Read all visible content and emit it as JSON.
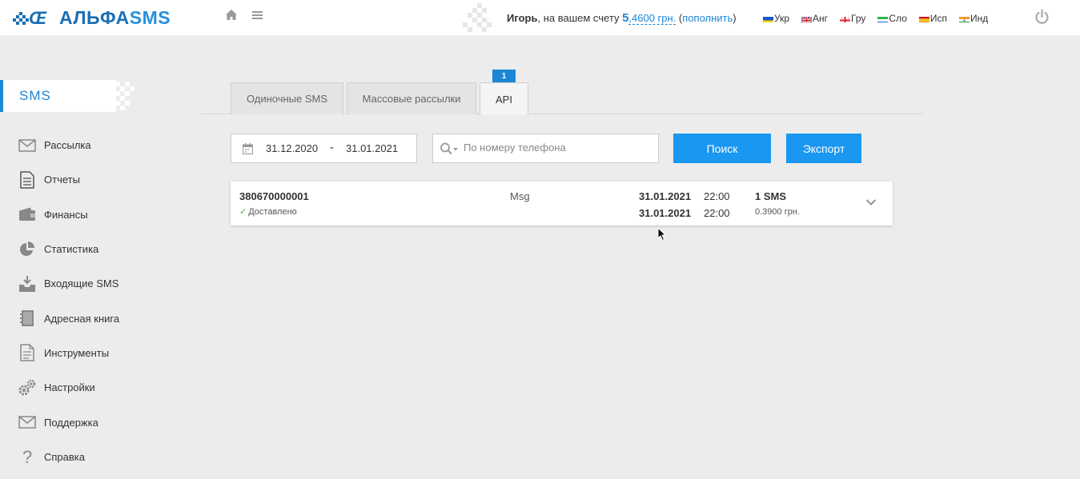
{
  "header": {
    "logo": {
      "alpha": "АЛЬФА",
      "sms": "SMS"
    },
    "account": {
      "user": "Игорь",
      "text": ", на вашем счету ",
      "balance_big": "5",
      "balance_rest": ",4600 грн.",
      "open_paren": " (",
      "topup": "пополнить",
      "close_paren": ")"
    },
    "languages": [
      {
        "label": "Укр",
        "flag": "ukraine"
      },
      {
        "label": "Анг",
        "flag": "uk"
      },
      {
        "label": "Гру",
        "flag": "georgia"
      },
      {
        "label": "Сло",
        "flag": "sierra-leone"
      },
      {
        "label": "Исп",
        "flag": "spain"
      },
      {
        "label": "Инд",
        "flag": "india"
      }
    ]
  },
  "sidebar": {
    "section": "SMS",
    "items": [
      {
        "label": "Рассылка",
        "icon": "envelope-icon"
      },
      {
        "label": "Отчеты",
        "icon": "document-icon"
      },
      {
        "label": "Финансы",
        "icon": "wallet-icon"
      },
      {
        "label": "Статистика",
        "icon": "pie-chart-icon"
      },
      {
        "label": "Входящие SMS",
        "icon": "inbox-download-icon"
      },
      {
        "label": "Адресная книга",
        "icon": "address-book-icon"
      },
      {
        "label": "Инструменты",
        "icon": "tools-document-icon"
      },
      {
        "label": "Настройки",
        "icon": "gears-icon"
      },
      {
        "label": "Поддержка",
        "icon": "envelope-icon"
      },
      {
        "label": "Справка",
        "icon": "question-icon"
      }
    ]
  },
  "tabs": [
    {
      "label": "Одиночные SMS",
      "active": false
    },
    {
      "label": "Массовые рассылки",
      "active": false
    },
    {
      "label": "API",
      "active": true,
      "badge": "1"
    }
  ],
  "filters": {
    "date_from": "31.12.2020",
    "date_separator": "-",
    "date_to": "31.01.2021",
    "phone_placeholder": "По номеру телефона",
    "search_label": "Поиск",
    "export_label": "Экспорт"
  },
  "results": [
    {
      "phone": "380670000001",
      "status": "Доставлено",
      "message": "Msg",
      "sent_date": "31.01.2021",
      "sent_time": "22:00",
      "delivered_date": "31.01.2021",
      "delivered_time": "22:00",
      "count": "1 SMS",
      "price": "0.3900 грн."
    }
  ],
  "colors": {
    "accent": "#1a87d6",
    "button": "#1a97f0",
    "success": "#3cb34a"
  }
}
